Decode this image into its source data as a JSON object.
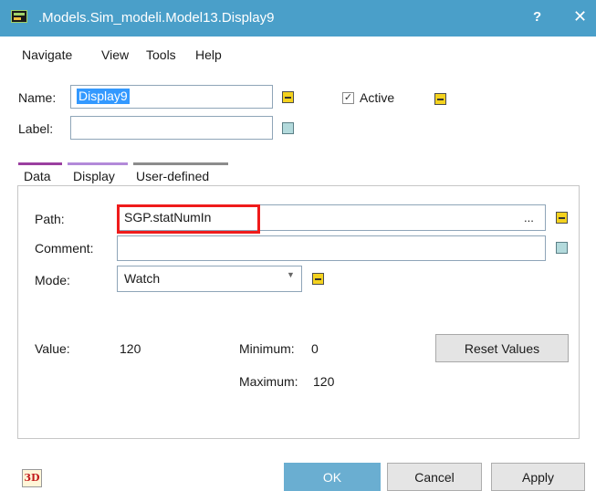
{
  "window": {
    "title": ".Models.Sim_modeli.Model13.Display9",
    "help_glyph": "?",
    "close_glyph": "✕",
    "app_icon": "display-app-icon"
  },
  "menu": {
    "items": [
      "Navigate",
      "View",
      "Tools",
      "Help"
    ]
  },
  "header": {
    "name_label": "Name:",
    "name_value": "Display9",
    "label_label": "Label:",
    "label_value": "",
    "active_label": "Active",
    "active_checked": true
  },
  "tabs": [
    {
      "label": "Data",
      "color": "#9b3fa0",
      "active": true
    },
    {
      "label": "Display",
      "color": "#b38ad9",
      "active": false
    },
    {
      "label": "User-defined",
      "color": "#8c8c8c",
      "active": false
    }
  ],
  "data_tab": {
    "path_label": "Path:",
    "path_value": "SGP.statNumIn",
    "path_browse": "...",
    "comment_label": "Comment:",
    "comment_value": "",
    "mode_label": "Mode:",
    "mode_value": "Watch",
    "mode_caret": "▼",
    "value_label": "Value:",
    "value": "120",
    "minimum_label": "Minimum:",
    "minimum": "0",
    "maximum_label": "Maximum:",
    "maximum": "120",
    "reset_button": "Reset Values"
  },
  "footer": {
    "icon_3d_label": "3D",
    "ok_button": "OK",
    "cancel_button": "Cancel",
    "apply_button": "Apply"
  },
  "colors": {
    "titlebar": "#4a9fc9",
    "highlight": "#ef1b1b",
    "inherit_marker": "#f4d21e",
    "empty_marker": "#b3dadc"
  }
}
